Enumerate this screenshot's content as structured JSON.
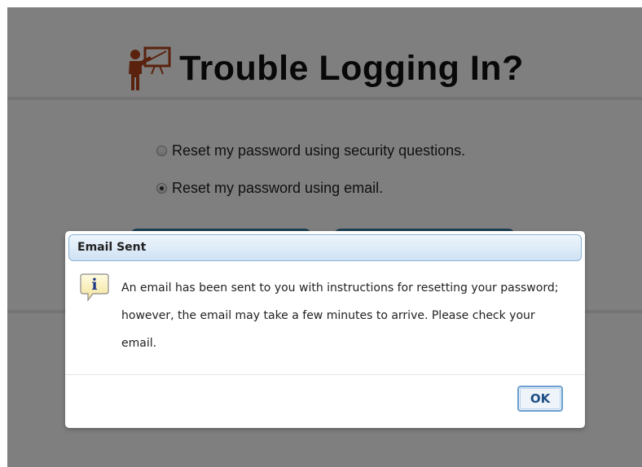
{
  "page": {
    "title": "Trouble Logging In?",
    "title_icon": "presenter-icon"
  },
  "options": [
    {
      "label": "Reset my password using security questions.",
      "checked": false
    },
    {
      "label": "Reset my password using email.",
      "checked": true
    }
  ],
  "dialog": {
    "title": "Email Sent",
    "icon": "info-icon",
    "message": "An email has been sent to you with instructions for resetting your password; however, the email may take a few minutes to arrive. Please check your email.",
    "ok_label": "OK"
  },
  "colors": {
    "overlay": "#808080",
    "title_icon": "#b5451b",
    "button_bg": "#3a7fa8",
    "dialog_header": "#cfe2f4",
    "ok_text": "#1f4e86"
  }
}
